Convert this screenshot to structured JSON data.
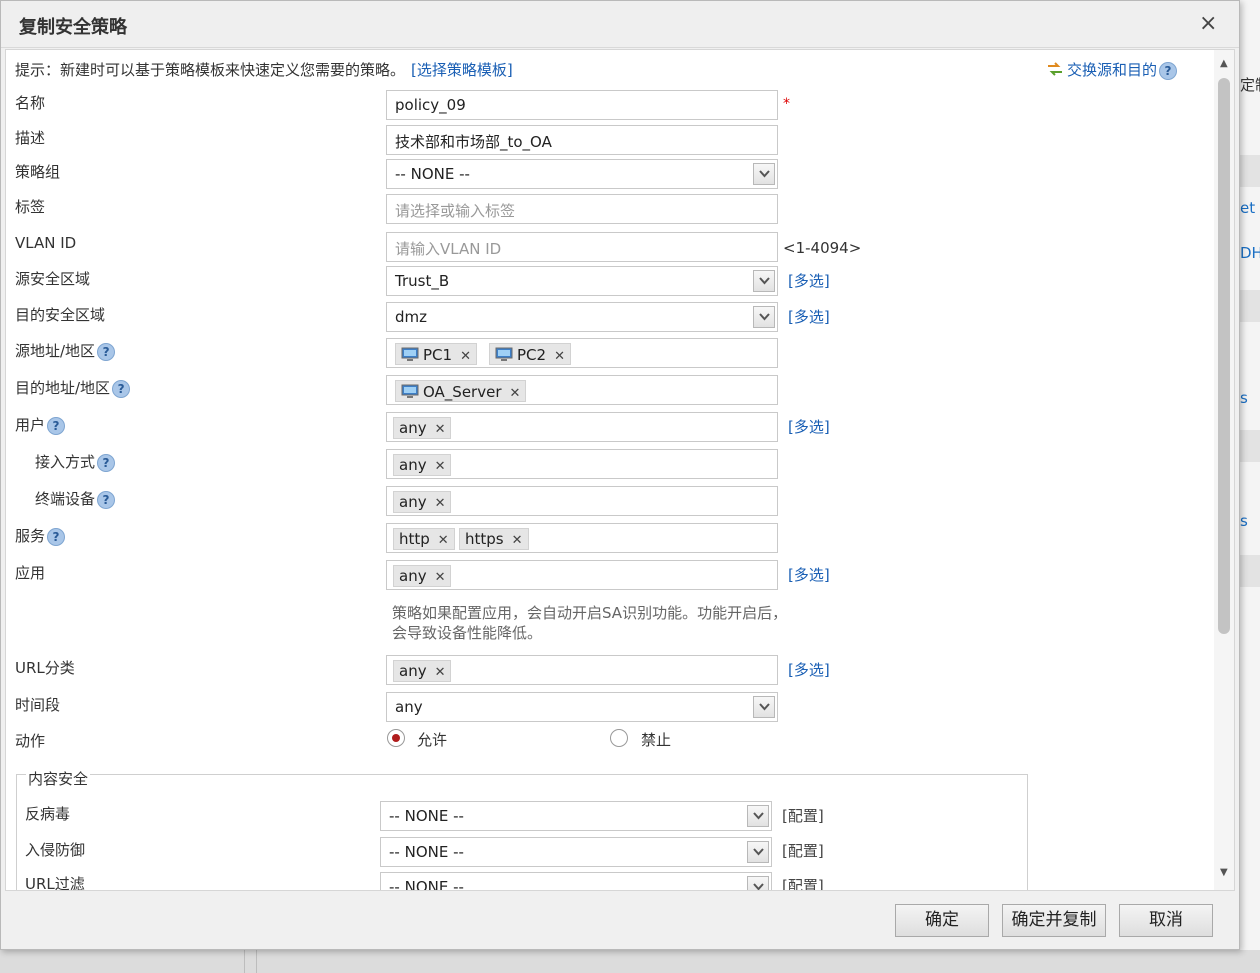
{
  "dialog": {
    "title": "复制安全策略",
    "close": "×",
    "hint": "提示：新建时可以基于策略模板来快速定义您需要的策略。",
    "hint_link": "[选择策略模板]",
    "swap_link": "交换源和目的"
  },
  "form": {
    "name": {
      "label": "名称",
      "value": "policy_09",
      "required": "*"
    },
    "desc": {
      "label": "描述",
      "value": "技术部和市场部_to_OA"
    },
    "group": {
      "label": "策略组",
      "value": "-- NONE --"
    },
    "tag": {
      "label": "标签",
      "placeholder": "请选择或输入标签"
    },
    "vlan": {
      "label": "VLAN ID",
      "placeholder": "请输入VLAN ID",
      "range": "<1-4094>"
    },
    "src_zone": {
      "label": "源安全区域",
      "value": "Trust_B",
      "multi": "[多选]"
    },
    "dst_zone": {
      "label": "目的安全区域",
      "value": "dmz",
      "multi": "[多选]"
    },
    "src_addr": {
      "label": "源地址/地区",
      "tags": [
        "PC1",
        "PC2"
      ]
    },
    "dst_addr": {
      "label": "目的地址/地区",
      "tags": [
        "OA_Server"
      ]
    },
    "user": {
      "label": "用户",
      "tags": [
        "any"
      ],
      "multi": "[多选]"
    },
    "access": {
      "label": "接入方式",
      "tags": [
        "any"
      ]
    },
    "terminal": {
      "label": "终端设备",
      "tags": [
        "any"
      ]
    },
    "service": {
      "label": "服务",
      "tags": [
        "http",
        "https"
      ]
    },
    "app": {
      "label": "应用",
      "tags": [
        "any"
      ],
      "multi": "[多选]",
      "note": "策略如果配置应用，会自动开启SA识别功能。功能开启后，会导致设备性能降低。"
    },
    "url": {
      "label": "URL分类",
      "tags": [
        "any"
      ],
      "multi": "[多选]"
    },
    "time": {
      "label": "时间段",
      "value": "any"
    },
    "action": {
      "label": "动作",
      "allow": "允许",
      "deny": "禁止",
      "selected": "允许"
    }
  },
  "content_security": {
    "legend": "内容安全",
    "antivirus": {
      "label": "反病毒",
      "value": "-- NONE --",
      "config": "[配置]"
    },
    "ips": {
      "label": "入侵防御",
      "value": "-- NONE --",
      "config": "[配置]"
    },
    "url_filter": {
      "label": "URL过滤",
      "value": "-- NONE --",
      "config": "[配置]"
    }
  },
  "footer": {
    "ok": "确定",
    "ok_copy": "确定并复制",
    "cancel": "取消"
  },
  "background": {
    "t1": "定制",
    "t2": "et",
    "t3": "DH",
    "t4": "s",
    "t5": "s"
  },
  "colors": {
    "link": "#1a5fb4",
    "required": "#dd0000",
    "radio_checked": "#b01c1c"
  }
}
